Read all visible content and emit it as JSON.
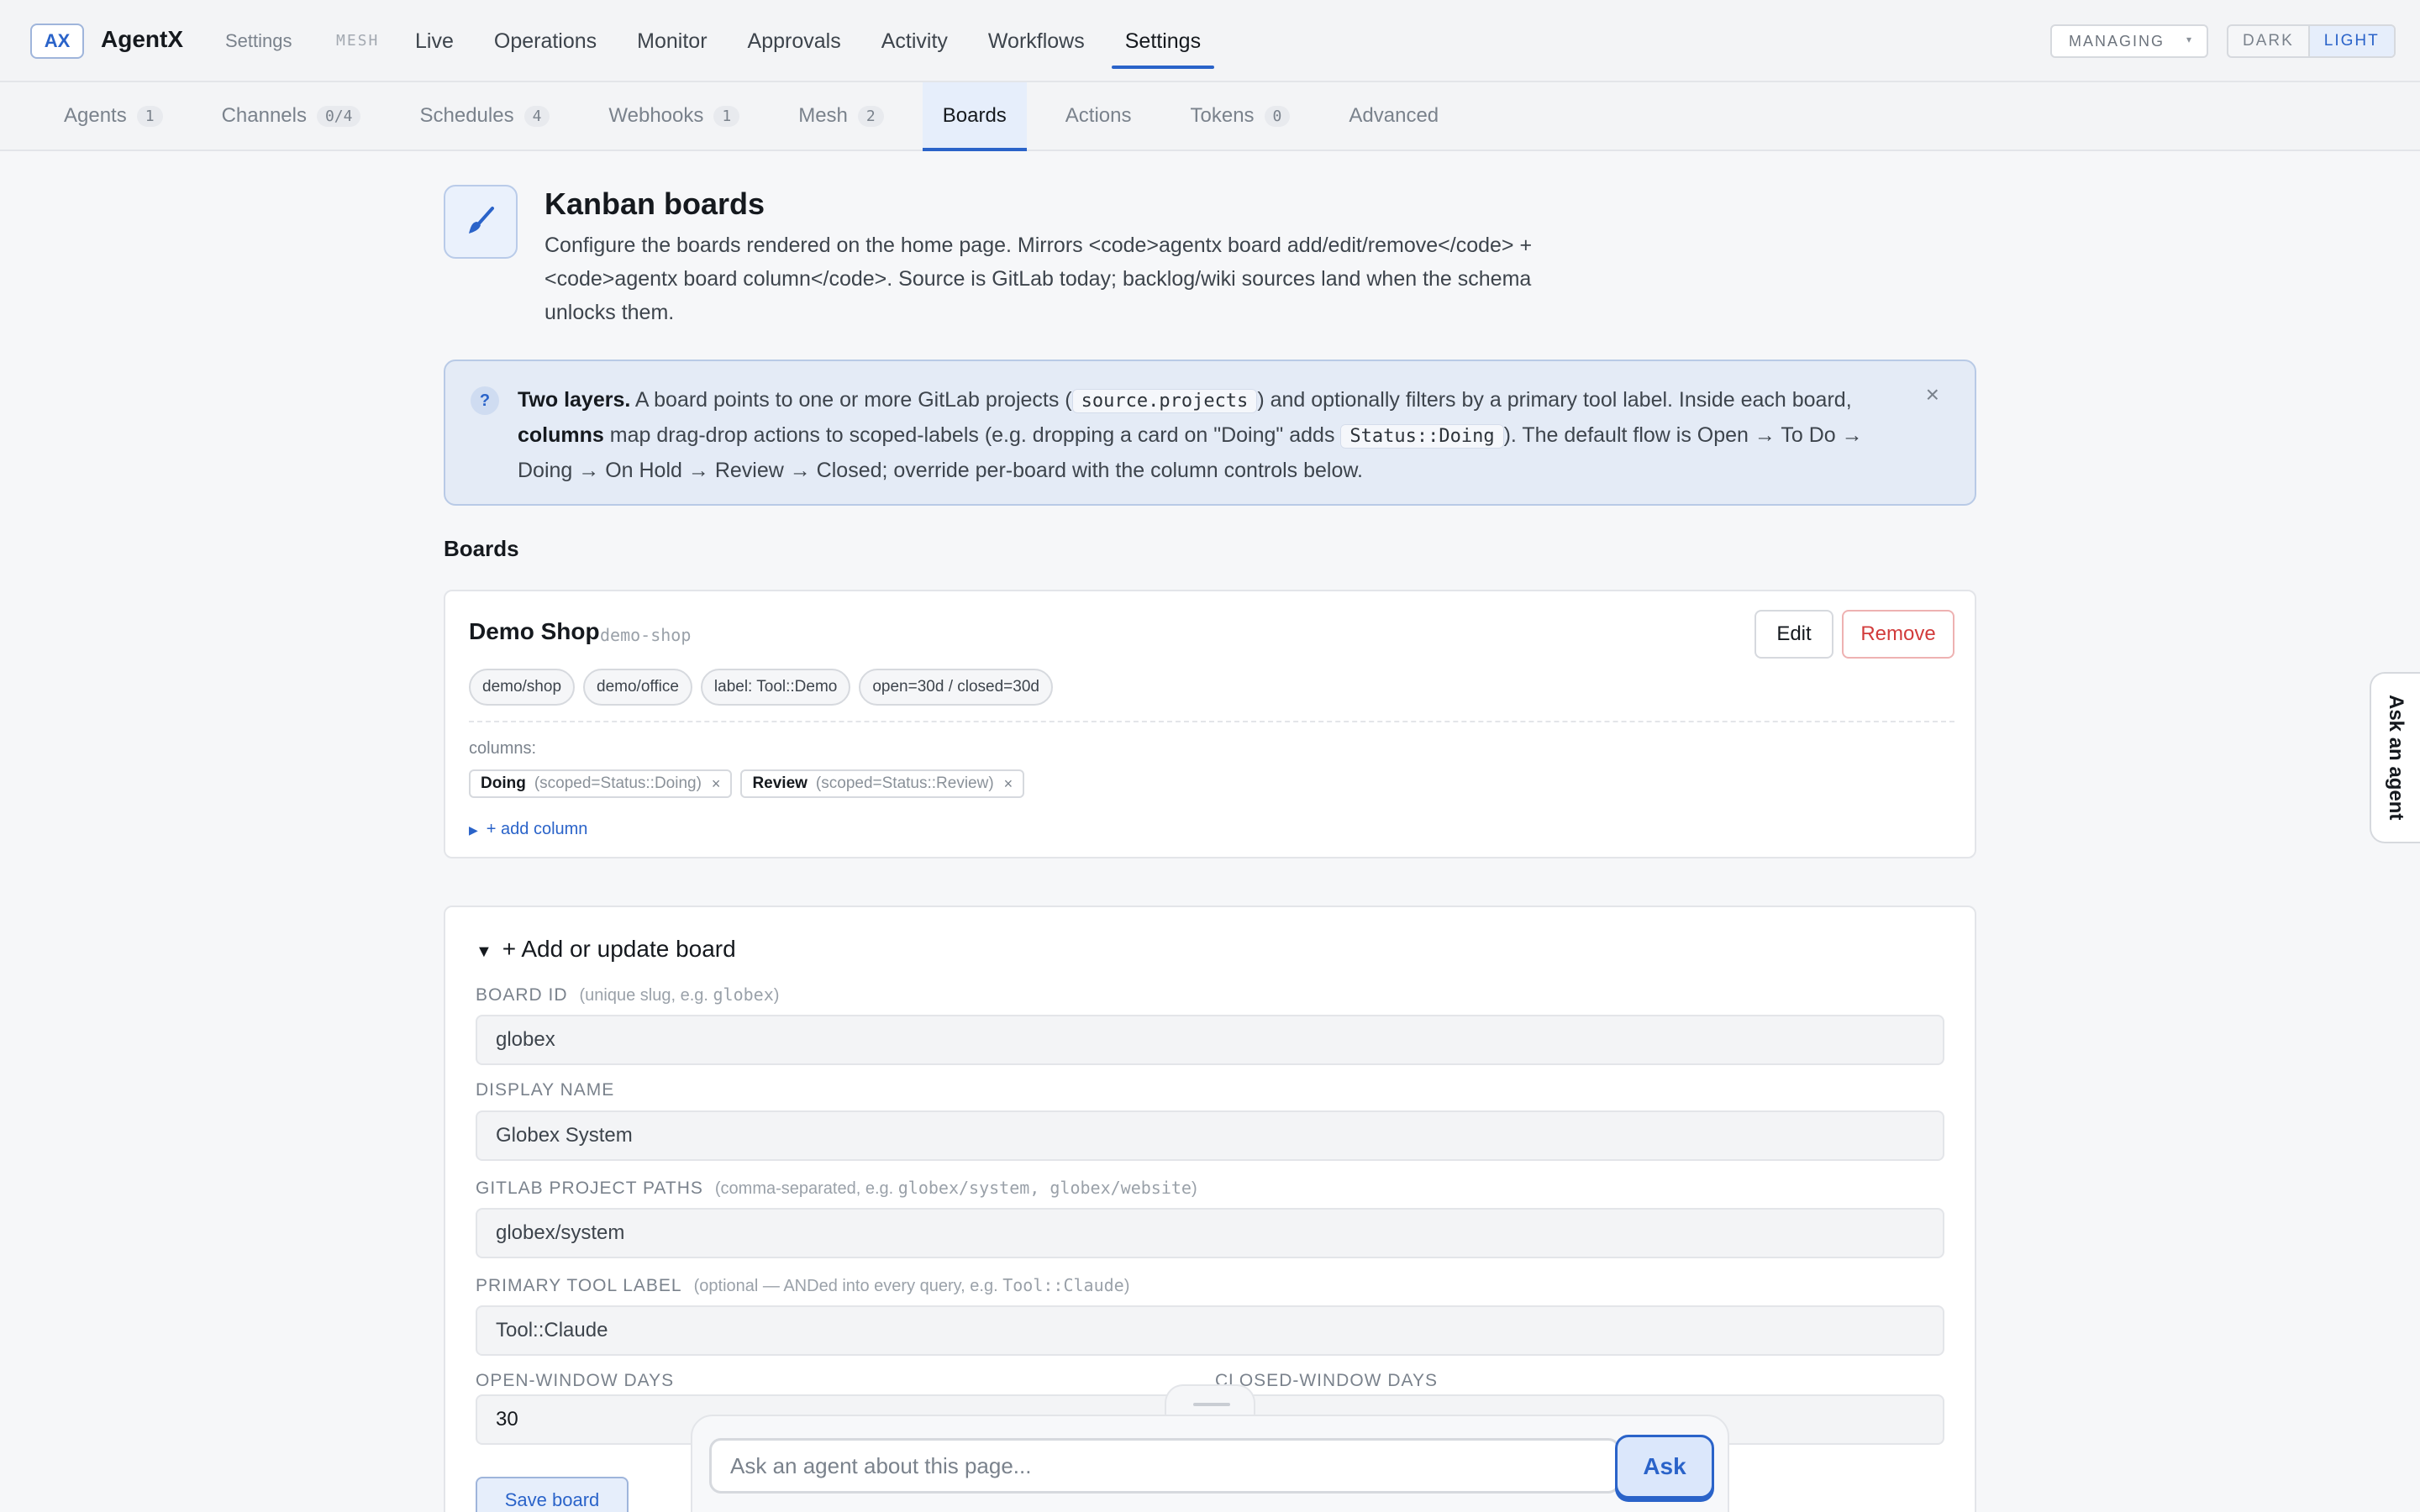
{
  "app": {
    "logo": "AX",
    "name": "AgentX",
    "crumb": "Settings",
    "mesh_tag": "MESH"
  },
  "main_nav": [
    {
      "label": "Live"
    },
    {
      "label": "Operations"
    },
    {
      "label": "Monitor"
    },
    {
      "label": "Approvals"
    },
    {
      "label": "Activity"
    },
    {
      "label": "Workflows"
    },
    {
      "label": "Settings",
      "active": true
    }
  ],
  "managing": {
    "label": "MANAGING",
    "caret": "▾"
  },
  "theme": {
    "dark": "DARK",
    "light": "LIGHT"
  },
  "sub_nav": [
    {
      "label": "Agents",
      "count": "1"
    },
    {
      "label": "Channels",
      "count": "0/4"
    },
    {
      "label": "Schedules",
      "count": "4"
    },
    {
      "label": "Webhooks",
      "count": "1"
    },
    {
      "label": "Mesh",
      "count": "2"
    },
    {
      "label": "Boards",
      "active": true
    },
    {
      "label": "Actions"
    },
    {
      "label": "Tokens",
      "count": "0"
    },
    {
      "label": "Advanced"
    }
  ],
  "header": {
    "title": "Kanban boards",
    "description": "Configure the boards rendered on the home page. Mirrors <code>agentx board add/edit/remove</code> + <code>agentx board column</code>. Source is GitLab today; backlog/wiki sources land when the schema unlocks them."
  },
  "callout": {
    "icon": "?",
    "p1_bold": "Two layers.",
    "p1": " A board points to one or more GitLab projects (",
    "code1": "source.projects",
    "p2": ") and optionally filters by a primary tool label. Inside each board, ",
    "p2_bold": "columns",
    "p3": " map drag-drop actions to scoped-labels (e.g. dropping a card on \"Doing\" adds ",
    "code2": "Status::Doing",
    "p4": "). The default flow is Open → To Do → Doing → On Hold → Review → Closed; override per-board with the column controls below.",
    "close": "×"
  },
  "boards_section": {
    "title": "Boards",
    "board": {
      "name": "Demo Shop",
      "slug": "demo-shop",
      "edit_label": "Edit",
      "remove_label": "Remove",
      "chips": [
        "demo/shop",
        "demo/office",
        "label: Tool::Demo",
        "open=30d / closed=30d"
      ],
      "columns_label": "columns:",
      "columns": [
        {
          "name": "Doing",
          "scope": "(scoped=Status::Doing)",
          "remove": "×"
        },
        {
          "name": "Review",
          "scope": "(scoped=Status::Review)",
          "remove": "×"
        }
      ],
      "add_column": "+ add column"
    }
  },
  "form": {
    "title": "+ Add or update board",
    "board_id": {
      "label": "BOARD ID",
      "hint_prefix": "(unique slug, e.g. ",
      "hint_code": "globex",
      "hint_suffix": ")",
      "value": "globex"
    },
    "display_name": {
      "label": "DISPLAY NAME",
      "value": "Globex System"
    },
    "project_paths": {
      "label": "GITLAB PROJECT PATHS",
      "hint_prefix": "(comma-separated, e.g. ",
      "hint_code": "globex/system, globex/website",
      "hint_suffix": ")",
      "value": "globex/system"
    },
    "tool_label": {
      "label": "PRIMARY TOOL LABEL",
      "hint_prefix": "(optional — ANDed into every query, e.g. ",
      "hint_code": "Tool::Claude",
      "hint_suffix": ")",
      "value": "Tool::Claude"
    },
    "open_days": {
      "label": "OPEN-WINDOW DAYS",
      "value": "30"
    },
    "closed_days": {
      "label": "CLOSED-WINDOW DAYS",
      "value": ""
    },
    "save_label": "Save board"
  },
  "ask": {
    "placeholder": "Ask an agent about this page...",
    "button": "Ask",
    "side_tab": "Ask an agent"
  }
}
